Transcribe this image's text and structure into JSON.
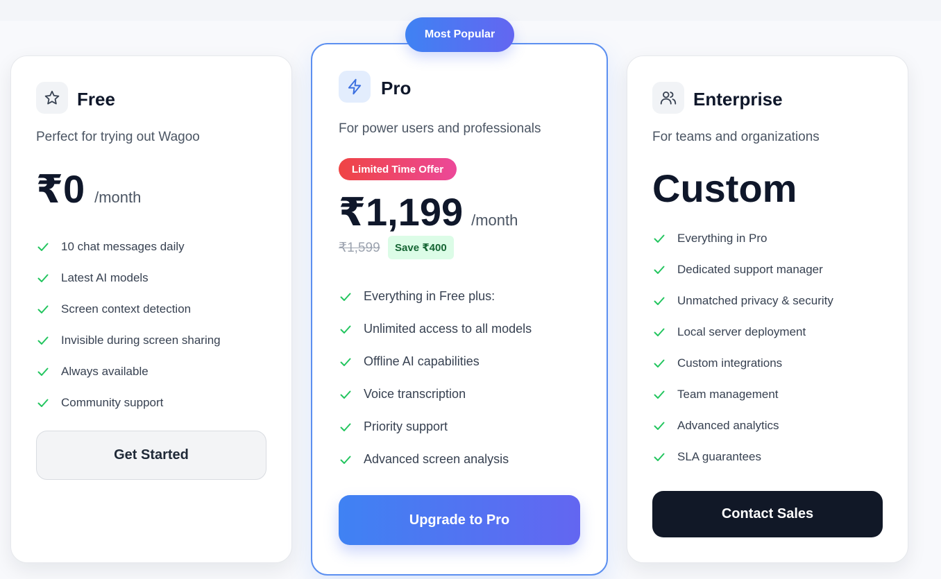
{
  "badge": {
    "most_popular": "Most Popular"
  },
  "plans": {
    "free": {
      "name": "Free",
      "icon": "star-icon",
      "description": "Perfect for trying out Wagoo",
      "price": "₹0",
      "period": "/month",
      "features": [
        "10 chat messages daily",
        "Latest AI models",
        "Screen context detection",
        "Invisible during screen sharing",
        "Always available",
        "Community support"
      ],
      "cta": "Get Started"
    },
    "pro": {
      "name": "Pro",
      "icon": "lightning-icon",
      "description": "For power users and professionals",
      "offer_label": "Limited Time Offer",
      "price": "₹1,199",
      "period": "/month",
      "original_price": "₹1,599",
      "savings": "Save ₹400",
      "features": [
        "Everything in Free plus:",
        "Unlimited access to all models",
        "Offline AI capabilities",
        "Voice transcription",
        "Priority support",
        "Advanced screen analysis"
      ],
      "cta": "Upgrade to Pro"
    },
    "enterprise": {
      "name": "Enterprise",
      "icon": "users-icon",
      "description": "For teams and organizations",
      "price": "Custom",
      "features": [
        "Everything in Pro",
        "Dedicated support manager",
        "Unmatched privacy & security",
        "Local server deployment",
        "Custom integrations",
        "Team management",
        "Advanced analytics",
        "SLA guarantees"
      ],
      "cta": "Contact Sales"
    }
  },
  "colors": {
    "accent_blue": "#3f82f3",
    "accent_indigo": "#6366f1",
    "check_green": "#22c55e",
    "offer_red": "#ef4444",
    "offer_pink": "#ec4899",
    "dark_button": "#111827"
  }
}
